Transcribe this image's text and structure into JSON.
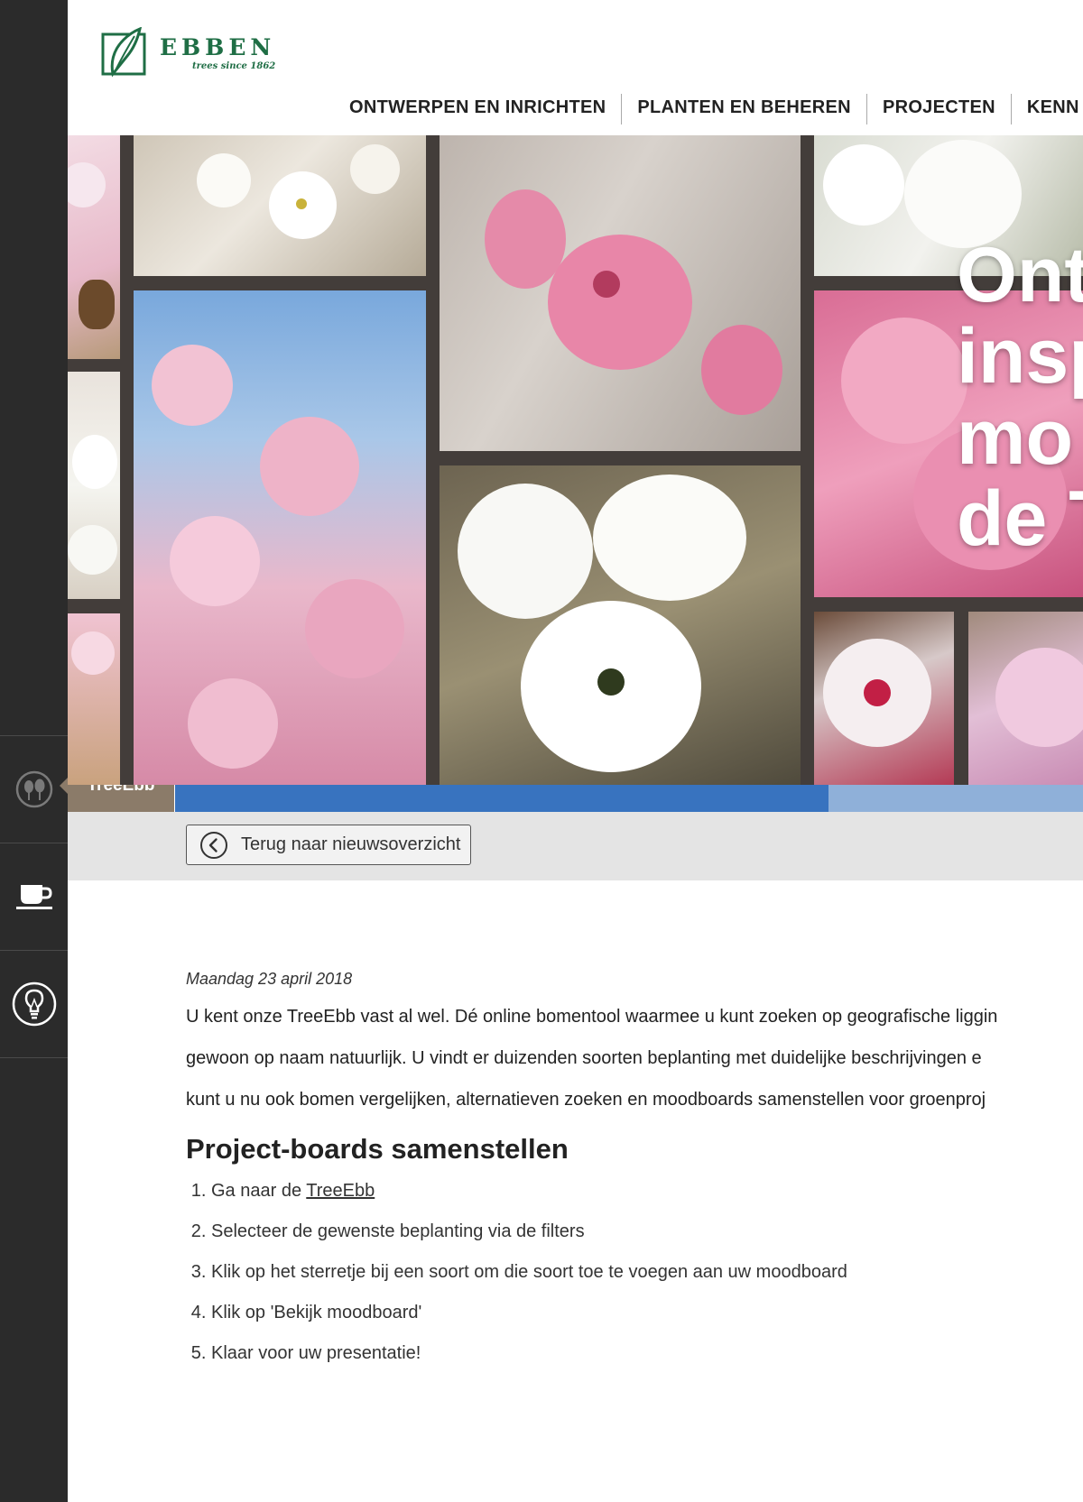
{
  "brand": {
    "name": "EBBEN",
    "tagline": "trees since 1862",
    "color": "#1f6e45"
  },
  "nav": {
    "items": [
      "ONTWERPEN EN INRICHTEN",
      "PLANTEN EN BEHEREN",
      "PROJECTEN",
      "KENN"
    ]
  },
  "sidebar": {
    "items": [
      {
        "icon": "trees-icon",
        "tooltip": "TreeEbb"
      },
      {
        "icon": "coffee-cup-icon"
      },
      {
        "icon": "lightbulb-icon"
      }
    ],
    "tooltip_color": "#8b7b69"
  },
  "hero": {
    "title_lines": [
      "Ont",
      "insp",
      "mo",
      "de T"
    ]
  },
  "progress": {
    "fraction": 0.72,
    "fill_color": "#3873bf",
    "track_color": "#8fb0d9"
  },
  "back": {
    "label": "Terug naar nieuwsoverzicht",
    "icon": "chevron-left-circle-icon"
  },
  "article": {
    "date": "Maandag 23 april 2018",
    "intro_lines": [
      "U kent onze TreeEbb vast al wel. Dé online bomentool waarmee u kunt zoeken op geografische liggin",
      "gewoon op naam natuurlijk. U vindt er duizenden soorten beplanting met duidelijke beschrijvingen e",
      "kunt u nu ook bomen vergelijken, alternatieven zoeken en moodboards samenstellen voor groenproj"
    ],
    "heading": "Project-boards samenstellen",
    "steps": {
      "step1_prefix": "Ga naar de ",
      "step1_link": "TreeEbb",
      "step2": "Selecteer de gewenste beplanting via de filters",
      "step3": "Klik op het sterretje bij een soort om die soort toe te voegen aan uw moodboard",
      "step4": "Klik op 'Bekijk moodboard'",
      "step5": "Klaar voor uw presentatie!"
    }
  }
}
